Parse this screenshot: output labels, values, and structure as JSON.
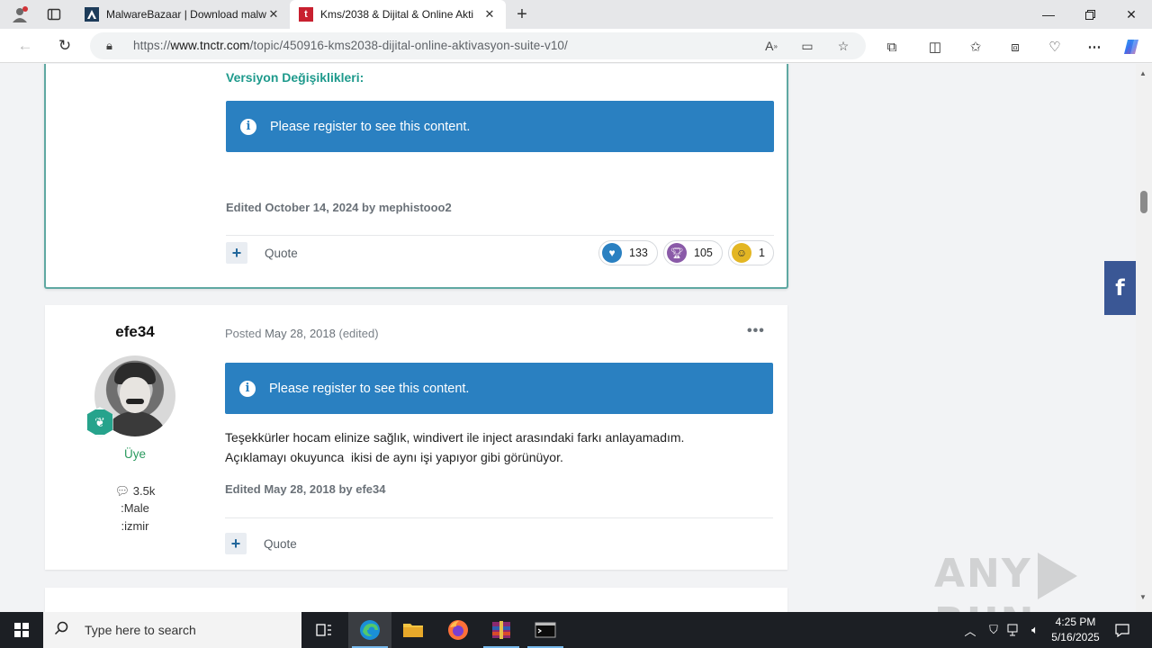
{
  "browser": {
    "tabs": [
      {
        "title": "MalwareBazaar | Download malw",
        "favicon": "malwarebazaar-icon",
        "active": false
      },
      {
        "title": "Kms/2038 & Dijital & Online Akti",
        "favicon": "tnctr-icon",
        "active": true
      }
    ],
    "url_prefix": "https://",
    "url_host": "www.tnctr.com",
    "url_path": "/topic/450916-kms2038-dijital-online-aktivasyon-suite-v10/"
  },
  "post1": {
    "version_title": "Versiyon Değişiklikleri:",
    "notice_text": "Please register to see this content.",
    "edited_prefix": "Edited ",
    "edited_date": "October 14, 2024",
    "edited_by_word": " by ",
    "edited_author": "mephistooo2",
    "quote_label": "Quote",
    "reactions": [
      {
        "name": "like",
        "count": "133",
        "color": "#2a80c1"
      },
      {
        "name": "trophy",
        "count": "105",
        "color": "#8a5aa8"
      },
      {
        "name": "thanks",
        "count": "1",
        "color": "#e3b623"
      }
    ]
  },
  "post2": {
    "author_name": "efe34",
    "rank": "Üye",
    "post_count": "3.5k",
    "gender": ":Male",
    "location": ":izmir",
    "posted_prefix": "Posted ",
    "posted_date": "May 28, 2018",
    "posted_suffix": " (edited)",
    "more_label": "•••",
    "notice_text": "Please register to see this content.",
    "body_line1": "Teşekkürler hocam elinize sağlık, windivert ile inject arasındaki farkı anlayamadım.",
    "body_line2": "Açıklamayı okuyunca  ikisi de aynı işi yapıyor gibi görünüyor.",
    "edited_text": "Edited May 28, 2018 by efe34",
    "quote_label": "Quote"
  },
  "social": {
    "facebook_label": "f"
  },
  "watermark": {
    "left": "ANY",
    "right": "RUN"
  },
  "taskbar": {
    "search_placeholder": "Type here to search",
    "time": "4:25 PM",
    "date": "5/16/2025"
  },
  "colors": {
    "accent_teal": "#1e9a8c",
    "notice_blue": "#2a80c1",
    "rank_green": "#2b9a5f"
  }
}
